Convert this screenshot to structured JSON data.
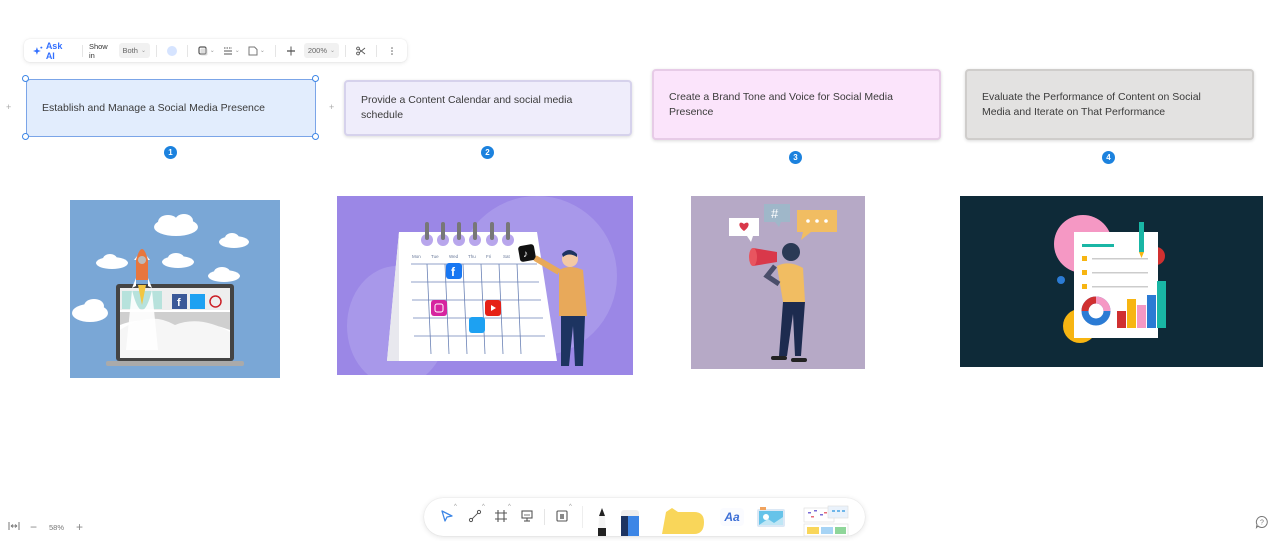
{
  "format_toolbar": {
    "ask_ai_label": "Ask AI",
    "show_in_label": "Show in",
    "show_in_value": "Both",
    "fill_color": "#d6e4ff",
    "zoom_value": "200%",
    "icons": [
      "sparkle-icon",
      "fill-color-icon",
      "border-style-icon",
      "line-style-icon",
      "shape-icon",
      "align-icon",
      "scissors-icon",
      "more-icon"
    ]
  },
  "steps": [
    {
      "number": "1",
      "text": "Establish and Manage a Social Media Presence",
      "color": "#e2edfd",
      "selected": true
    },
    {
      "number": "2",
      "text": "Provide a Content Calendar and social media schedule",
      "color": "#efedfb",
      "selected": false
    },
    {
      "number": "3",
      "text": "Create a Brand Tone and Voice for Social Media Presence",
      "color": "#fbe4fb",
      "selected": false
    },
    {
      "number": "4",
      "text": "Evaluate the Performance of Content on Social Media and Iterate on That Performance",
      "color": "#e3e2e1",
      "selected": false
    }
  ],
  "illustrations": [
    {
      "name": "rocket-laptop-illustration",
      "bg": "#7aa7d6"
    },
    {
      "name": "content-calendar-illustration",
      "bg": "#9b87e6",
      "weekdays": [
        "Mon",
        "Tue",
        "Wed",
        "Thu",
        "Fri",
        "Sat"
      ]
    },
    {
      "name": "megaphone-person-illustration",
      "bg": "#b6a9c6",
      "bubble_symbol": "#"
    },
    {
      "name": "report-analytics-illustration",
      "bg": "#0e2a38"
    }
  ],
  "bottom_toolbar": {
    "tools": [
      "select",
      "connector",
      "frame",
      "presentation",
      "note",
      "pen",
      "marker",
      "sticky-note",
      "text",
      "image",
      "templates"
    ],
    "text_tool_label": "Aa"
  },
  "zoom_controls": {
    "zoom_level": "58%",
    "minus": "−",
    "plus": "+"
  },
  "accent_color": "#1c82de"
}
